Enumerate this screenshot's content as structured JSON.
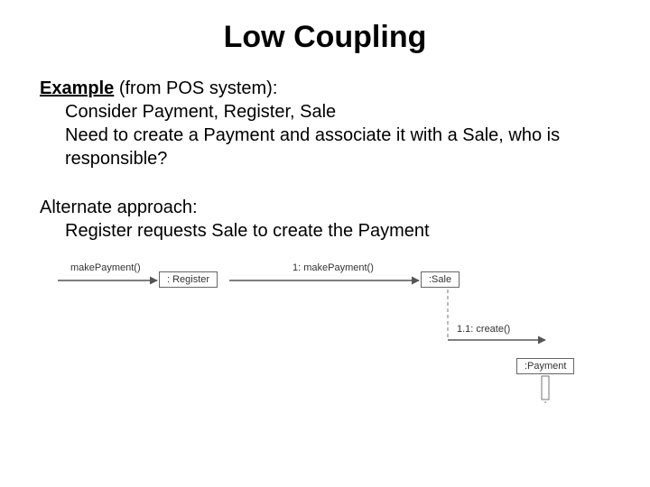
{
  "title": "Low Coupling",
  "example": {
    "label": "Example",
    "suffix": " (from POS system):",
    "line1": "Consider Payment, Register, Sale",
    "line2": "Need to create a Payment and associate it with a Sale, who is responsible?"
  },
  "alt": {
    "heading": "Alternate approach:",
    "line": "Register requests Sale to create the Payment"
  },
  "diagram": {
    "msg_make_payment": "makePayment()",
    "msg_1_make_payment": "1: makePayment()",
    "msg_11_create": "1.1: create()",
    "box_register": ": Register",
    "box_sale": ":Sale",
    "box_payment": ":Payment"
  }
}
